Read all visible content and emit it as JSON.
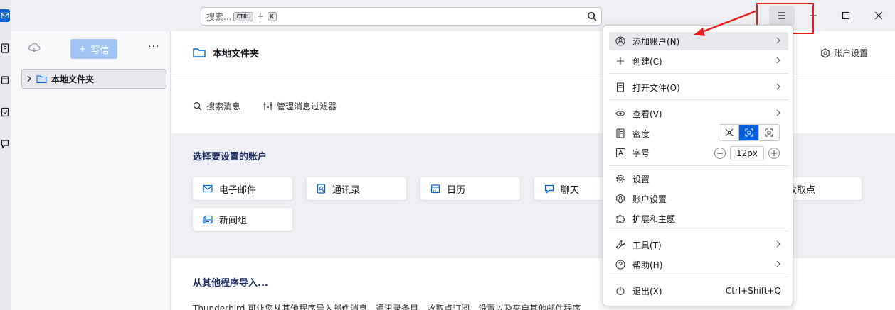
{
  "topbar": {
    "search_placeholder": "搜索...",
    "kbd_ctrl": "CTRL",
    "kbd_plus": "+",
    "kbd_k": "K"
  },
  "spaces": [
    "mail-icon",
    "addressbook-icon",
    "calendar-icon",
    "tasks-icon",
    "chat-icon"
  ],
  "folderpane": {
    "write_label": "写信",
    "more_label": "···",
    "folder_label": "本地文件夹"
  },
  "main": {
    "header_title": "本地文件夹",
    "account_settings": "账户设置",
    "search_messages": "搜索消息",
    "manage_filters": "管理消息过滤器",
    "setup_title": "选择要设置的账户",
    "cards": [
      {
        "label": "电子邮件",
        "icon": "mail-icon"
      },
      {
        "label": "通讯录",
        "icon": "addressbook-icon"
      },
      {
        "label": "日历",
        "icon": "calendar-icon"
      },
      {
        "label": "聊天",
        "icon": "chat-icon"
      },
      {
        "label": "收取点",
        "icon": "feed-icon"
      },
      {
        "label": "新闻组",
        "icon": "newsgroup-icon"
      }
    ],
    "import_title": "从其他程序导入...",
    "import_text": "Thunderbird 可让您从其他程序导入邮件消息、通讯录条目、收取点订阅、设置以及来自其他邮件程序"
  },
  "menu": {
    "add_account": "添加账户(N)",
    "create": "创建(C)",
    "open_file": "打开文件(O)",
    "view": "查看(V)",
    "density": "密度",
    "font_size": "字号",
    "font_value": "12px",
    "minus": "−",
    "plus": "+",
    "settings": "设置",
    "account_settings": "账户设置",
    "addons": "扩展和主题",
    "tools": "工具(T)",
    "help": "帮助(H)",
    "quit": "退出(X)",
    "quit_shortcut": "Ctrl+Shift+Q"
  },
  "colors": {
    "accent": "#0060df",
    "annotation": "#e61e1e"
  }
}
